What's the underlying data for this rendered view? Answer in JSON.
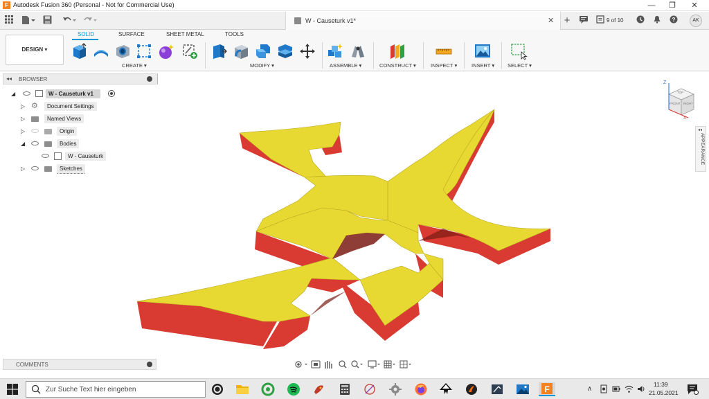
{
  "window": {
    "title": "Autodesk Fusion 360 (Personal - Not for Commercial Use)",
    "logo_letter": "F",
    "minimize_glyph": "—",
    "maximize_glyph": "❐",
    "close_glyph": "✕"
  },
  "tabbar": {
    "doc_title": "W - Causeturk v1*",
    "close_glyph": "✕",
    "new_tab_glyph": "+",
    "job_status": "9 of 10",
    "avatar_initials": "AK",
    "notification_count": ""
  },
  "toolbar": {
    "workspace_label": "DESIGN ▾",
    "tabs": [
      "SOLID",
      "SURFACE",
      "SHEET METAL",
      "TOOLS"
    ],
    "groups": {
      "create": "CREATE ▾",
      "modify": "MODIFY ▾",
      "assemble": "ASSEMBLE ▾",
      "construct": "CONSTRUCT ▾",
      "inspect": "INSPECT ▾",
      "insert": "INSERT ▾",
      "select": "SELECT ▾"
    }
  },
  "browser": {
    "title": "BROWSER",
    "items": [
      {
        "label": "W - Causeturk v1"
      },
      {
        "label": "Document Settings"
      },
      {
        "label": "Named Views"
      },
      {
        "label": "Origin"
      },
      {
        "label": "Bodies"
      },
      {
        "label": "W - Causeturk"
      },
      {
        "label": "Sketches"
      }
    ]
  },
  "comments": {
    "label": "COMMENTS"
  },
  "appearance": {
    "label": "APPEARANCE"
  },
  "viewcube": {
    "axis_z": "Z",
    "axis_x": "X",
    "face_top": "TOP",
    "face_front": "FRONT",
    "face_right": "RIGHT"
  },
  "taskbar": {
    "search_placeholder": "Zur Suche Text hier eingeben",
    "time": "11:39",
    "date": "21.05.2021"
  },
  "colors": {
    "accent": "#0696d7",
    "model_top": "#e8d832",
    "model_side": "#d93a32",
    "fusion_orange": "#f58220"
  }
}
